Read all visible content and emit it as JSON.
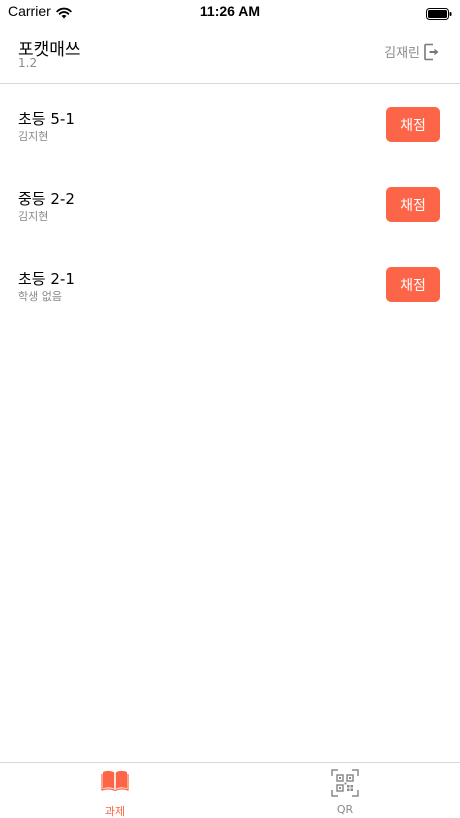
{
  "status_bar": {
    "carrier": "Carrier",
    "time": "11:26 AM"
  },
  "header": {
    "title": "포캣매쓰",
    "version": "1.2",
    "user_name": "김재린"
  },
  "classes": [
    {
      "name": "초등 5-1",
      "student": "김지현",
      "action": "채점"
    },
    {
      "name": "중등 2-2",
      "student": "김지현",
      "action": "채점"
    },
    {
      "name": "초등 2-1",
      "student": "학생 없음",
      "action": "채점"
    }
  ],
  "tabs": [
    {
      "label": "과제",
      "icon": "book-icon",
      "active": true
    },
    {
      "label": "QR",
      "icon": "qr-code-icon",
      "active": false
    }
  ],
  "colors": {
    "accent": "#fd6548",
    "muted_text": "#8a8a8a",
    "divider": "#d9d9d9"
  }
}
